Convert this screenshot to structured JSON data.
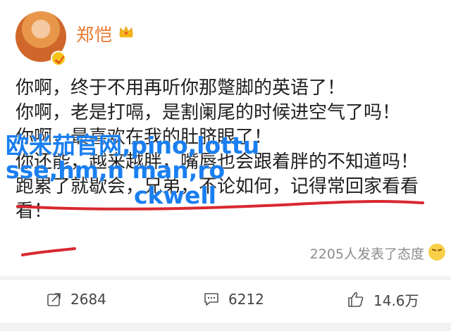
{
  "post": {
    "username": "郑恺",
    "lines": [
      "你啊，终于不用再听你那蹩脚的英语了！",
      "你啊，老是打嗝，是割阑尾的时候进空气了吗！",
      "你啊，最喜欢在我的肚脐眼了！",
      "你还能，越来越胖，嘴唇也会跟着胖的不知道吗！",
      "跑累了就歇会，兄弟，不论如何，记得常回家看看",
      "看！"
    ],
    "reactions": "2205人发表了态度"
  },
  "watermark": {
    "line1": "欧米茄官网,pino,lottu",
    "line2": "sse,hm,n man,ro",
    "line3": "ckwell"
  },
  "actions": {
    "repost_count": "2684",
    "comment_count": "6212",
    "like_count": "14.6万"
  },
  "colors": {
    "username": "#e8762d",
    "watermark": "#1a7ff0",
    "underline": "#d9282f"
  }
}
